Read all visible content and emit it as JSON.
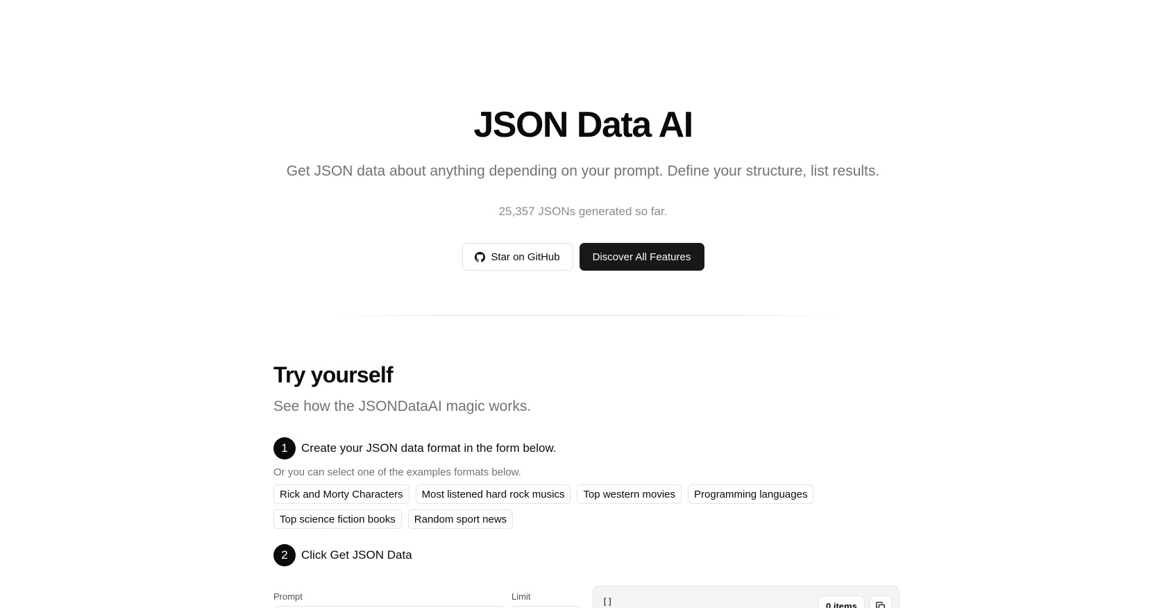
{
  "hero": {
    "title": "JSON Data AI",
    "subtitle": "Get JSON data about anything depending on your prompt. Define your structure, list results.",
    "count_text": "25,357 JSONs generated so far.",
    "github_button": "Star on GitHub",
    "features_button": "Discover All Features"
  },
  "try_section": {
    "title": "Try yourself",
    "subtitle": "See how the JSONDataAI magic works.",
    "step1": {
      "number": "1",
      "text": "Create your JSON data format in the form below."
    },
    "hint": "Or you can select one of the examples formats below.",
    "examples": [
      "Rick and Morty Characters",
      "Most listened hard rock musics",
      "Top western movies",
      "Programming languages",
      "Top science fiction books",
      "Random sport news"
    ],
    "step2": {
      "number": "2",
      "text": "Click Get JSON Data"
    },
    "form": {
      "prompt_label": "Prompt",
      "limit_label": "Limit"
    },
    "output": {
      "json_text": "[]",
      "items_badge": "0 items"
    }
  },
  "icons": {
    "github": "github-icon",
    "copy": "copy-icon"
  },
  "colors": {
    "primary": "#18181b",
    "muted_text": "#71717a",
    "border": "#e4e4e7",
    "output_bg": "#f4f4f5"
  }
}
